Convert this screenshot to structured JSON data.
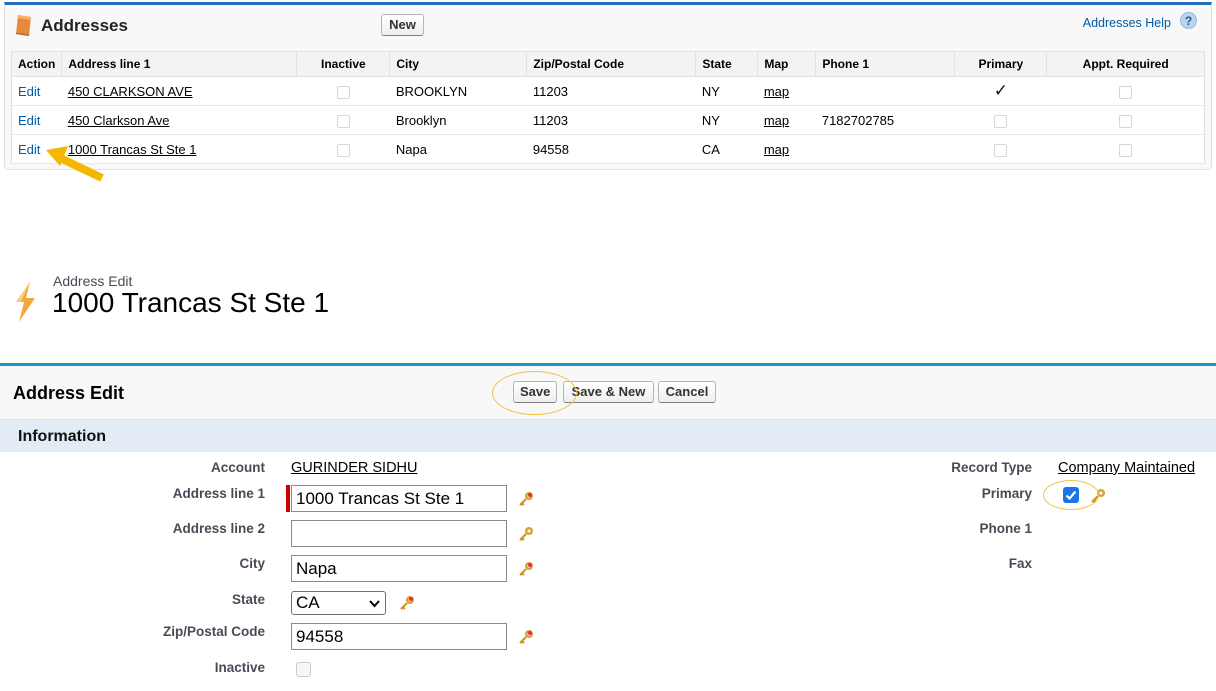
{
  "related_list": {
    "title": "Addresses",
    "new_label": "New",
    "help_label": "Addresses Help",
    "help_icon": "?",
    "columns": [
      "Action",
      "Address line 1",
      "Inactive",
      "City",
      "Zip/Postal Code",
      "State",
      "Map",
      "Phone 1",
      "Primary",
      "Appt. Required"
    ],
    "rows": [
      {
        "action": "Edit",
        "address": "450 CLARKSON AVE",
        "inactive": false,
        "city": "BROOKLYN",
        "zip": "11203",
        "state": "NY",
        "map": "map",
        "phone": "",
        "primary": true,
        "appt": false
      },
      {
        "action": "Edit",
        "address": "450 Clarkson Ave",
        "inactive": false,
        "city": "Brooklyn",
        "zip": "11203",
        "state": "NY",
        "map": "map",
        "phone": "7182702785",
        "primary": false,
        "appt": false
      },
      {
        "action": "Edit",
        "address": "1000 Trancas St Ste 1",
        "inactive": false,
        "city": "Napa",
        "zip": "94558",
        "state": "CA",
        "map": "map",
        "phone": "",
        "primary": false,
        "appt": false
      }
    ],
    "check_glyph": "✓"
  },
  "page_header": {
    "type": "Address Edit",
    "title": "1000 Trancas St Ste 1"
  },
  "edit": {
    "title": "Address Edit",
    "save_label": "Save",
    "save_new_label": "Save & New",
    "cancel_label": "Cancel",
    "section_title": "Information",
    "fields": {
      "account_label": "Account",
      "account_value": "GURINDER SIDHU",
      "address1_label": "Address line 1",
      "address1_value": "1000 Trancas St Ste 1",
      "address2_label": "Address line 2",
      "address2_value": "",
      "city_label": "City",
      "city_value": "Napa",
      "state_label": "State",
      "state_value": "CA",
      "zip_label": "Zip/Postal Code",
      "zip_value": "94558",
      "inactive_label": "Inactive",
      "inactive_checked": false,
      "record_type_label": "Record Type",
      "record_type_value": "Company Maintained",
      "primary_label": "Primary",
      "primary_checked": true,
      "phone_label": "Phone 1",
      "fax_label": "Fax"
    }
  },
  "colors": {
    "panel_accent": "#236fbd",
    "edit_accent": "#1797c0",
    "link": "#015ba7",
    "annotation": "#f2c440",
    "arrow": "#f5b800",
    "required": "#cc0000"
  },
  "icons": [
    "addresses-book-icon",
    "help-icon",
    "checkmark-icon",
    "arrow-annotation-icon",
    "lightning-address-icon",
    "key-icon",
    "chevron-down-icon"
  ]
}
